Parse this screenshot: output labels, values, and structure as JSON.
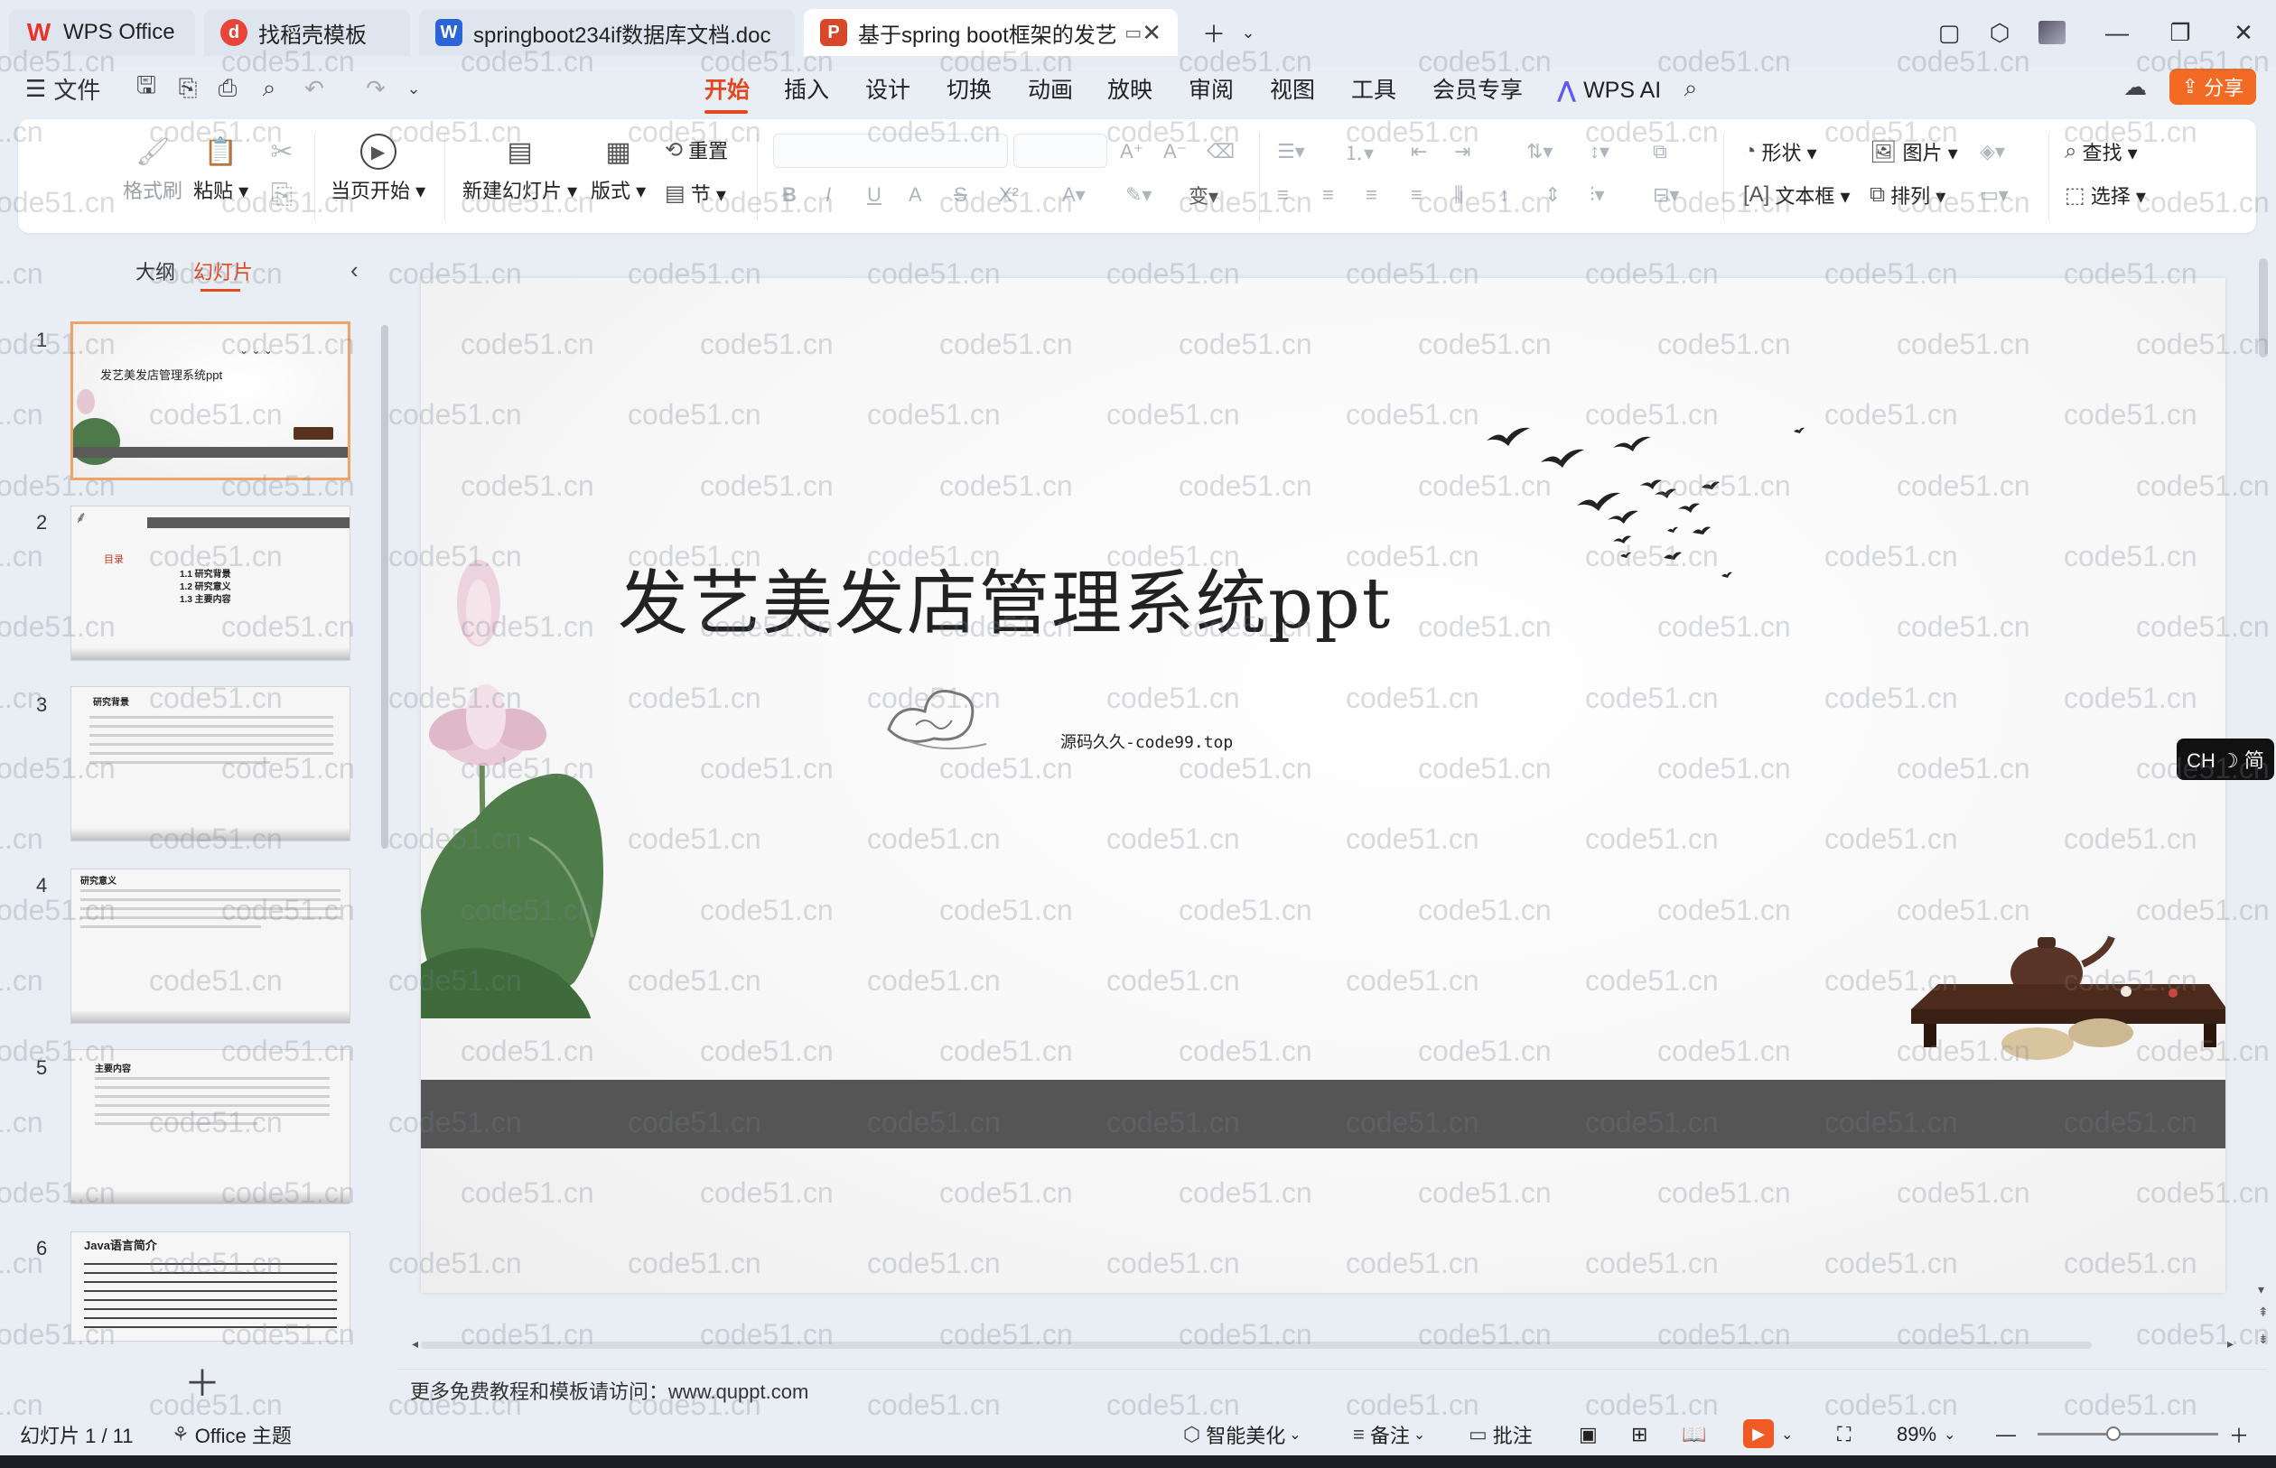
{
  "tabs": [
    {
      "label": "WPS Office",
      "icon": "wps-logo-icon",
      "color": "#e8322a",
      "active": false
    },
    {
      "label": "找稻壳模板",
      "icon": "docer-icon",
      "color": "#e8443a",
      "active": false
    },
    {
      "label": "springboot234if数据库文档.doc",
      "icon": "word-doc-icon",
      "color": "#2b63d9",
      "active": false
    },
    {
      "label": "基于spring boot框架的发艺",
      "icon": "ppt-doc-icon",
      "color": "#d9472b",
      "active": true
    }
  ],
  "menu": {
    "file": "文件",
    "items": [
      "开始",
      "插入",
      "设计",
      "切换",
      "动画",
      "放映",
      "审阅",
      "视图",
      "工具",
      "会员专享"
    ],
    "active": "开始",
    "ai": "WPS AI",
    "share": "分享"
  },
  "ribbon": {
    "format_painter": "格式刷",
    "paste": "粘贴",
    "play_from_current": "当页开始",
    "new_slide": "新建幻灯片",
    "layout": "版式",
    "reset": "重置",
    "section": "节",
    "shape": "形状",
    "picture": "图片",
    "find": "查找",
    "textbox": "文本框",
    "arrange": "排列",
    "select": "选择"
  },
  "left_pane": {
    "tab_outline": "大纲",
    "tab_slides": "幻灯片",
    "thumbnails": [
      {
        "num": "1",
        "title": "发艺美发店管理系统ppt"
      },
      {
        "num": "2",
        "title": "目录",
        "items": [
          "1.1 研究背景",
          "1.2 研究意义",
          "1.3 主要内容"
        ]
      },
      {
        "num": "3",
        "title": "研究背景"
      },
      {
        "num": "4",
        "title": "研究意义"
      },
      {
        "num": "5",
        "title": "主要内容"
      },
      {
        "num": "6",
        "title": "Java语言简介"
      }
    ]
  },
  "slide": {
    "title": "发艺美发店管理系统ppt",
    "subtitle": "源码久久-code99.top"
  },
  "notes": "更多免费教程和模板请访问：www.quppt.com",
  "ime": "CH ☽ 简",
  "status": {
    "slide_counter": "幻灯片 1 / 11",
    "theme": "Office 主题",
    "beautify": "智能美化",
    "notes": "备注",
    "comments": "批注",
    "zoom": "89%"
  },
  "watermark": "code51.cn",
  "colors": {
    "accent": "#e2481f",
    "share_button": "#f26a23",
    "band": "#555555"
  }
}
